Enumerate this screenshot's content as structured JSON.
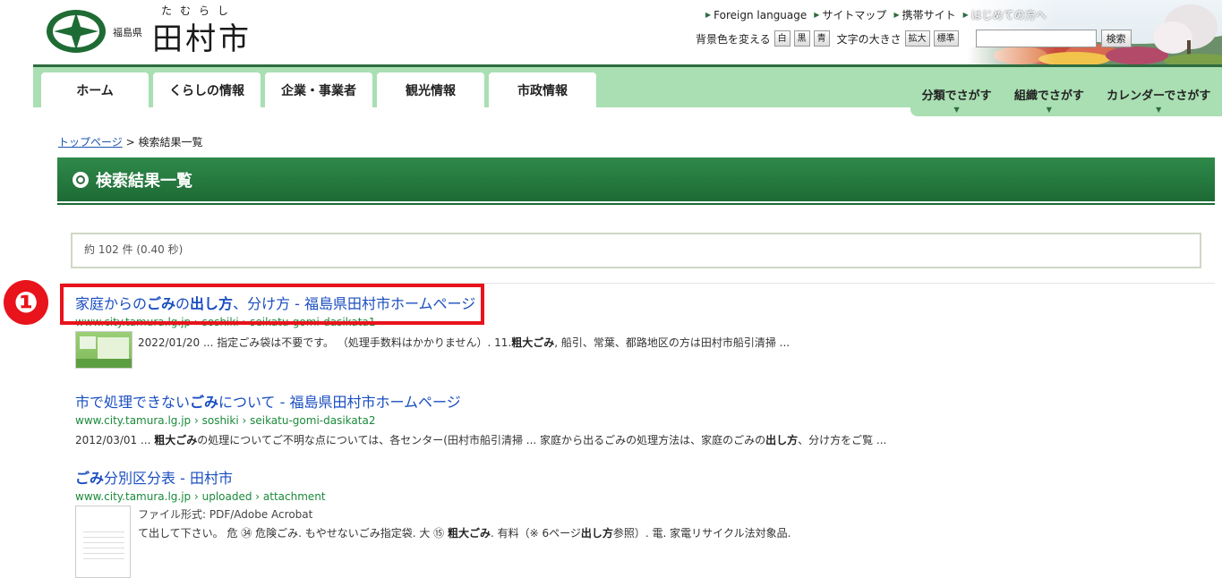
{
  "header": {
    "prefecture": "福島県",
    "city_name": "田村市",
    "city_ruby": "たむらし",
    "links": [
      "Foreign language",
      "サイトマップ",
      "携帯サイト",
      "はじめての方へ"
    ],
    "bg_color_label": "背景色を変える",
    "bg_buttons": [
      "白",
      "黒",
      "青"
    ],
    "font_size_label": "文字の大きさ",
    "font_buttons": [
      "拡大",
      "標準"
    ],
    "search_placeholder": "",
    "search_button": "検索"
  },
  "nav": {
    "tabs": [
      "ホーム",
      "くらしの情報",
      "企業・事業者",
      "観光情報",
      "市政情報"
    ],
    "sub": [
      "分類でさがす",
      "組織でさがす",
      "カレンダーでさがす"
    ]
  },
  "breadcrumb": {
    "home": "トップページ",
    "separator": " > ",
    "current": "検索結果一覧"
  },
  "page_title": "検索結果一覧",
  "summary": "約 102 件 (0.40 秒)",
  "results": [
    {
      "title_parts": [
        "家庭からの",
        "ごみ",
        "の",
        "出し方",
        "、分け方 - 福島県田村市ホームページ"
      ],
      "url": "www.city.tamura.lg.jp › soshiki › seikatu-gomi-dasikata1",
      "date": "2022/01/20",
      "snippet_parts": [
        " ... 指定ごみ袋は不要です。 （処理手数料はかかりません）. 11.",
        "粗大ごみ",
        ", 船引、常葉、都路地区の方は田村市船引清掃 ..."
      ]
    },
    {
      "title_parts": [
        "市で処理できない",
        "ごみ",
        "について - 福島県田村市ホームページ"
      ],
      "url": "www.city.tamura.lg.jp › soshiki › seikatu-gomi-dasikata2",
      "date": "2012/03/01",
      "snippet_parts": [
        " ... ",
        "粗大ごみ",
        "の処理についてご不明な点については、各センター(田村市船引清掃 ... 家庭から出るごみの処理方法は、家庭のごみの",
        "出し方",
        "、分け方をご覧 ..."
      ]
    },
    {
      "title_parts": [
        "ごみ",
        "分別区分表 - 田村市"
      ],
      "url": "www.city.tamura.lg.jp › uploaded › attachment",
      "filetype": "ファイル形式: PDF/Adobe Acrobat",
      "snippet_parts": [
        "て出して下さい。 危 ㉞ 危険ごみ. もやせないごみ指定袋. 大 ⑮ ",
        "粗大ごみ",
        ". 有料（※ 6ページ",
        "出し方",
        "参照）. 電. 家電リサイクル法対象品."
      ]
    }
  ],
  "annotation": {
    "badge": "❶",
    "color": "#e8131b"
  },
  "colors": {
    "brand_green": "#2e6b3f",
    "nav_band": "#a9dfb2",
    "link_blue": "#1a4ec0",
    "url_green": "#1a8a3a"
  }
}
